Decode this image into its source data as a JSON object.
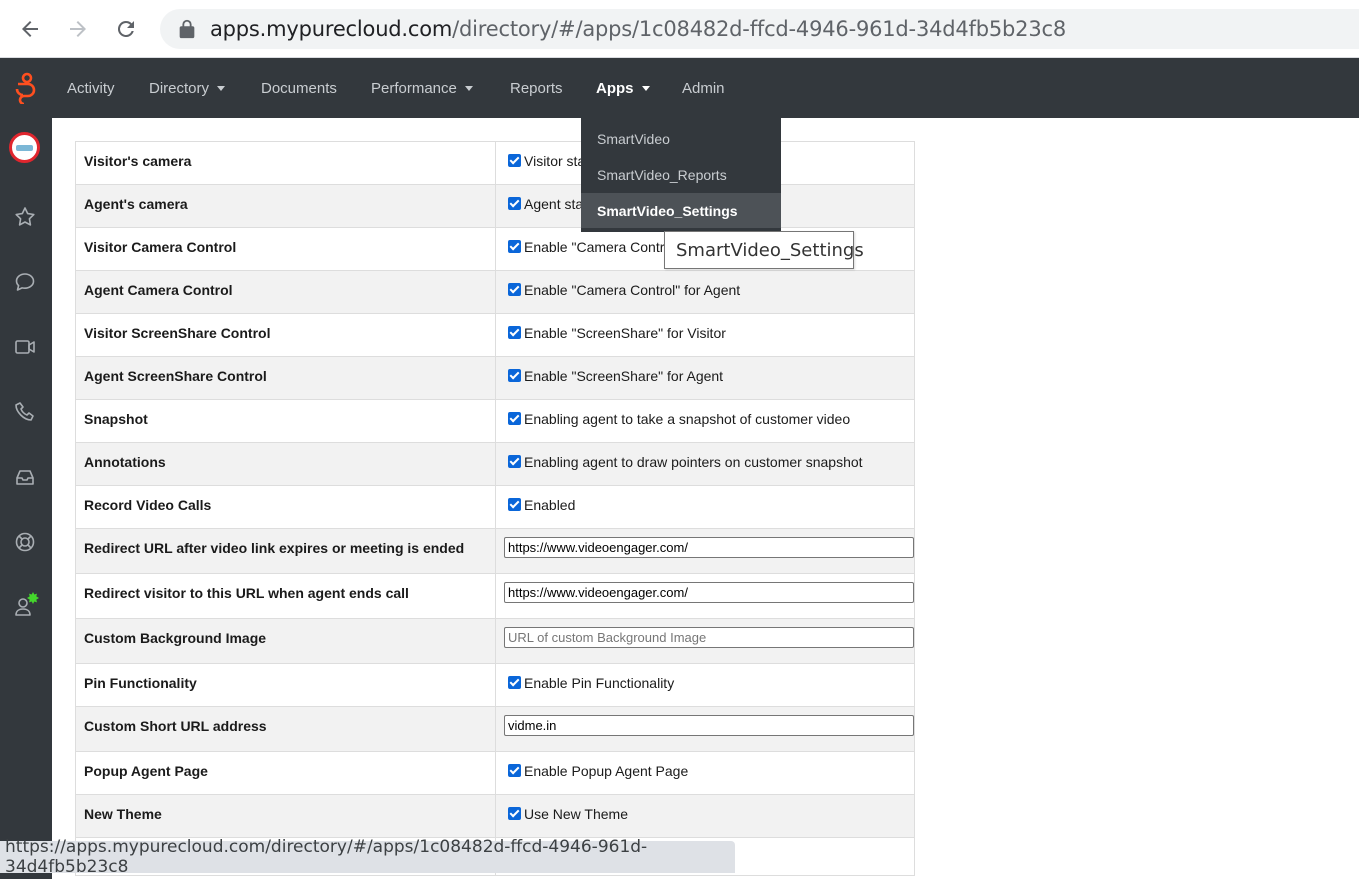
{
  "browser": {
    "url_host": "apps.mypurecloud.com",
    "url_path": "/directory/#/apps/1c08482d-ffcd-4946-961d-34d4fb5b23c8"
  },
  "nav": {
    "items": [
      {
        "label": "Activity"
      },
      {
        "label": "Directory"
      },
      {
        "label": "Documents"
      },
      {
        "label": "Performance"
      },
      {
        "label": "Reports"
      },
      {
        "label": "Apps"
      },
      {
        "label": "Admin"
      }
    ],
    "active": "Apps"
  },
  "apps_menu": {
    "items": [
      {
        "label": "SmartVideo"
      },
      {
        "label": "SmartVideo_Reports"
      },
      {
        "label": "SmartVideo_Settings"
      }
    ]
  },
  "tooltip": "SmartVideo_Settings",
  "settings": {
    "rows": [
      {
        "label": "Visitor's camera",
        "value": "Visitor sta"
      },
      {
        "label": "Agent's camera",
        "value": "Agent sta"
      },
      {
        "label": "Visitor Camera Control",
        "value": "Enable \"Camera Contr"
      },
      {
        "label": "Agent Camera Control",
        "value": "Enable \"Camera Control\" for Agent"
      },
      {
        "label": "Visitor ScreenShare Control",
        "value": "Enable \"ScreenShare\" for Visitor"
      },
      {
        "label": "Agent ScreenShare Control",
        "value": "Enable \"ScreenShare\" for Agent"
      },
      {
        "label": "Snapshot",
        "value": "Enabling agent to take a snapshot of customer video"
      },
      {
        "label": "Annotations",
        "value": "Enabling agent to draw pointers on customer snapshot"
      },
      {
        "label": "Record Video Calls",
        "value": "Enabled"
      },
      {
        "label": "Redirect URL after video link expires or meeting is ended",
        "input_value": "https://www.videoengager.com/"
      },
      {
        "label": "Redirect visitor to this URL when agent ends call",
        "input_value": "https://www.videoengager.com/"
      },
      {
        "label": "Custom Background Image",
        "placeholder": "URL of custom Background Image"
      },
      {
        "label": "Pin Functionality",
        "value": "Enable Pin Functionality"
      },
      {
        "label": "Custom Short URL address",
        "input_value": "vidme.in"
      },
      {
        "label": "Popup Agent Page",
        "value": "Enable Popup Agent Page"
      },
      {
        "label": "New Theme",
        "value": "Use New Theme"
      }
    ]
  },
  "status_bar": "https://apps.mypurecloud.com/directory/#/apps/1c08482d-ffcd-4946-961d-34d4fb5b23c8",
  "colors": {
    "nav_bg": "#33383d",
    "brand_orange": "#ff4f1f",
    "checkbox": "#0a66d9",
    "status_green": "#44d62c"
  },
  "icons": [
    "back-icon",
    "forward-icon",
    "reload-icon",
    "lock-icon",
    "genesys-logo",
    "star-icon",
    "chat-icon",
    "video-icon",
    "phone-icon",
    "inbox-icon",
    "help-icon",
    "user-status-icon"
  ]
}
